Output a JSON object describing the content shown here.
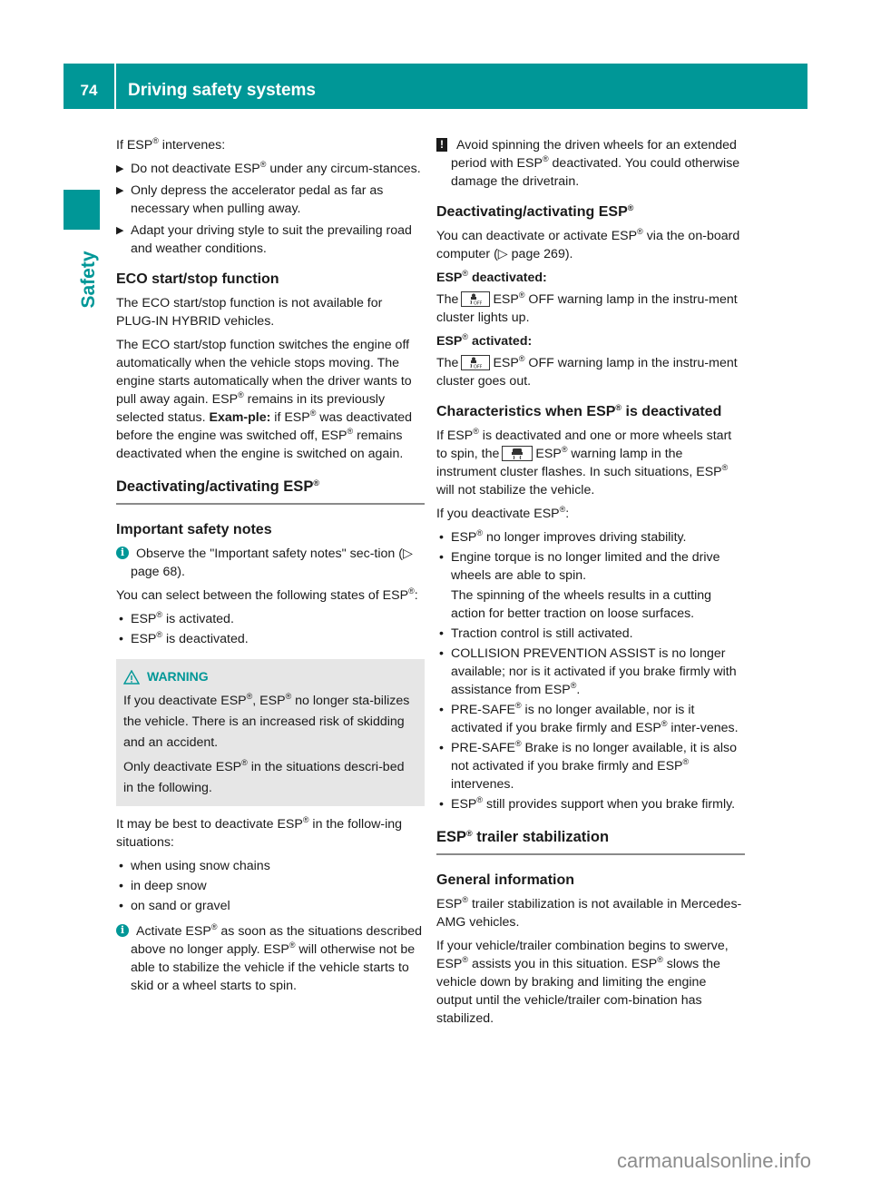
{
  "header": {
    "page_number": "74",
    "title": "Driving safety systems",
    "accent_color": "#009797"
  },
  "side_tab": {
    "label": "Safety"
  },
  "left_column": {
    "intervene_intro": [
      "If ESP",
      "®",
      " intervenes:"
    ],
    "intervene_steps": [
      [
        "Do not deactivate ESP",
        "®",
        " under any circum-stances."
      ],
      [
        "Only depress the accelerator pedal as far as necessary when pulling away."
      ],
      [
        "Adapt your driving style to suit the prevailing road and weather conditions."
      ]
    ],
    "eco": {
      "heading": "ECO start/stop function",
      "p1": "The ECO start/stop function is not available for PLUG-IN HYBRID vehicles.",
      "p2_a": "The ECO start/stop function switches the engine off automatically when the vehicle stops moving. The engine starts automatically when the driver wants to pull away again. ESP",
      "p2_b": " remains in its previously selected status. ",
      "p2_bold": "Exam-ple:",
      "p2_c": " if ESP",
      "p2_d": " was deactivated before the engine was switched off, ESP",
      "p2_e": " remains deactivated when the engine is switched on again."
    },
    "deact_section": {
      "heading": "Deactivating/activating ESP",
      "subheading": "Important safety notes",
      "info_note": "Observe the \"Important safety notes\" sec-tion (▷ page 68).",
      "states_intro_a": "You can select between the following states of ESP",
      "states_intro_b": ":",
      "states": [
        " is activated.",
        " is deactivated."
      ],
      "warning": {
        "title": "WARNING",
        "p1_a": "If you deactivate ESP",
        "p1_b": ", ESP",
        "p1_c": " no longer sta-bilizes the vehicle. There is an increased risk of skidding and an accident.",
        "p2_a": "Only deactivate ESP",
        "p2_b": " in the situations descri-bed in the following."
      },
      "situations_intro_a": "It may be best to deactivate ESP",
      "situations_intro_b": " in the follow-ing situations:",
      "situations": [
        "when using snow chains",
        "in deep snow",
        "on sand or gravel"
      ],
      "activate_note_a": "Activate ESP",
      "activate_note_b": " as soon as the situations described above no longer apply. ESP",
      "activate_note_c": " will otherwise not be able to stabilize the vehicle if the vehicle starts to skid or a wheel starts to spin."
    }
  },
  "right_column": {
    "caution_a": "Avoid spinning the driven wheels for an extended period with ESP",
    "caution_b": " deactivated. You could otherwise damage the drivetrain.",
    "deact_heading": "Deactivating/activating ESP",
    "deact_p_a": "You can deactivate or activate ESP",
    "deact_p_b": " via the on-board computer (▷ page 269).",
    "deactivated_label": " deactivated:",
    "deactivated_text_a": "The",
    "deactivated_text_b": "ESP",
    "deactivated_text_c": " OFF warning lamp in the instru-ment cluster lights up.",
    "activated_label": " activated:",
    "activated_text_c": " OFF warning lamp in the instru-ment cluster goes out.",
    "characteristics": {
      "heading_a": "Characteristics when ESP",
      "heading_b": " is deactivated",
      "p1_a": "If ESP",
      "p1_b": " is deactivated and one or more wheels start to spin, the",
      "p1_c": "ESP",
      "p1_d": " warning lamp in the instrument cluster flashes. In such situations, ESP",
      "p1_e": " will not stabilize the vehicle.",
      "p2_a": "If you deactivate ESP",
      "p2_b": ":",
      "items": [
        {
          "a": "ESP",
          "reg": true,
          "b": " no longer improves driving stability."
        },
        {
          "a": "Engine torque is no longer limited and the drive wheels are able to spin.",
          "reg": false,
          "b": "",
          "sub": "The spinning of the wheels results in a cutting action for better traction on loose surfaces."
        },
        {
          "a": "Traction control is still activated.",
          "reg": false,
          "b": ""
        },
        {
          "a": "COLLISION PREVENTION ASSIST is no longer available; nor is it activated if you brake firmly with assistance from ESP",
          "reg": true,
          "b": "."
        },
        {
          "a": "PRE-SAFE",
          "reg": true,
          "b": " is no longer available, nor is it activated if you brake firmly and ESP",
          "reg2": true,
          "c": " inter-venes."
        },
        {
          "a": "PRE-SAFE",
          "reg": true,
          "b": " Brake is no longer available, it is also not activated if you brake firmly and ESP",
          "reg2": true,
          "c": " intervenes."
        },
        {
          "a": "ESP",
          "reg": true,
          "b": " still provides support when you brake firmly."
        }
      ]
    },
    "trailer": {
      "heading_a": "ESP",
      "heading_b": " trailer stabilization",
      "subheading": "General information",
      "p1_a": "ESP",
      "p1_b": " trailer stabilization is not available in Mercedes-AMG vehicles.",
      "p2_a": "If your vehicle/trailer combination begins to swerve, ESP",
      "p2_b": " assists you in this situation. ESP",
      "p2_c": " slows the vehicle down by braking and limiting the engine output until the vehicle/trailer com-bination has stabilized."
    }
  },
  "common": {
    "esp": "ESP",
    "reg": "®",
    "the": "The",
    "bullet": "•",
    "arrow": "▶",
    "info": "i",
    "excl": "!"
  },
  "watermark": "carmanualsonline.info"
}
